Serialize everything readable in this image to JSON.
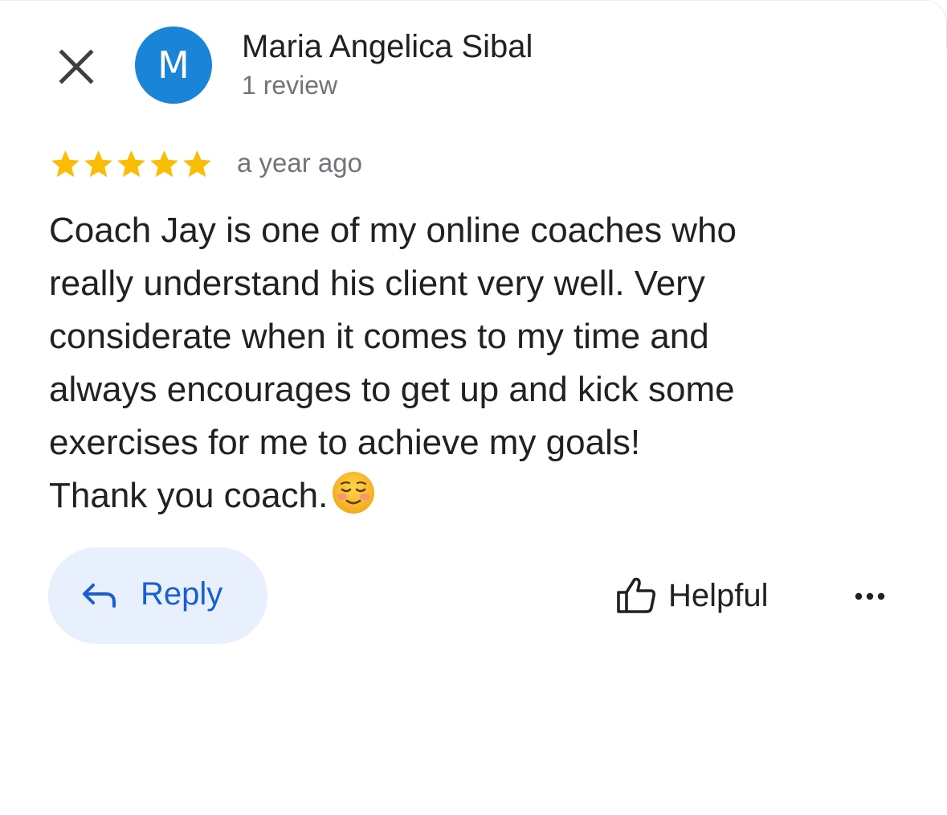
{
  "header": {
    "close_icon": "close-icon",
    "avatar_letter": "M",
    "avatar_color": "#1a84d6",
    "author_name": "Maria Angelica Sibal",
    "review_count": "1 review"
  },
  "rating": {
    "stars": 5,
    "max_stars": 5,
    "star_color": "#fbbc04",
    "time_ago": "a year ago"
  },
  "review": {
    "lines": [
      "Coach Jay is one of my online coaches who",
      "really understand his client very well. Very",
      "considerate when it comes to my time and",
      "always encourages to get up and kick some",
      "exercises for me to achieve my goals!",
      "Thank you coach."
    ],
    "emoji_icon": "smiling-face-icon"
  },
  "actions": {
    "reply_label": "Reply",
    "reply_icon": "reply-arrow-icon",
    "helpful_label": "Helpful",
    "helpful_icon": "thumbs-up-icon",
    "more_icon": "more-horizontal-icon",
    "reply_color": "#1a5fd0",
    "reply_bg": "#e8f0fd"
  }
}
